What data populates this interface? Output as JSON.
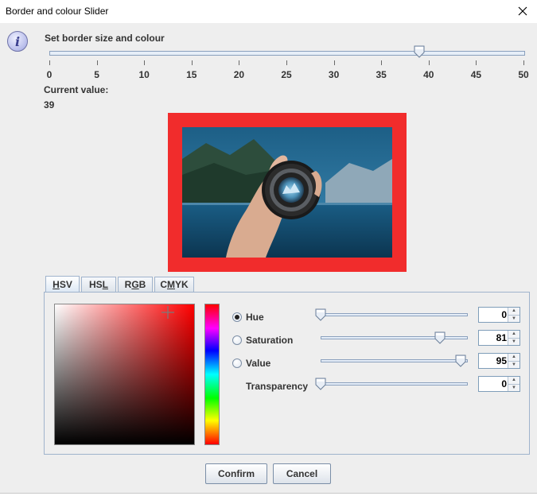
{
  "window": {
    "title": "Border and colour Slider"
  },
  "header": {
    "text": "Set border size and colour"
  },
  "border_slider": {
    "min": 0,
    "max": 50,
    "value": 39,
    "tick_labels": [
      "0",
      "5",
      "10",
      "15",
      "20",
      "25",
      "30",
      "35",
      "40",
      "45",
      "50"
    ]
  },
  "current_value": {
    "label": "Current value:",
    "value": "39"
  },
  "preview": {
    "border_color": "#f12c2c"
  },
  "tabs": [
    {
      "label": "HSV",
      "mnemonic_index": 0
    },
    {
      "label": "HSL",
      "mnemonic_index": 2
    },
    {
      "label": "RGB",
      "mnemonic_index": 1
    },
    {
      "label": "CMYK",
      "mnemonic_index": 1
    }
  ],
  "active_tab": "HSV",
  "hsv": {
    "hue": {
      "label": "Hue",
      "value": "0",
      "fraction": 0.0,
      "checked": true
    },
    "saturation": {
      "label": "Saturation",
      "value": "81",
      "fraction": 0.81,
      "checked": false
    },
    "value": {
      "label": "Value",
      "value": "95",
      "fraction": 0.95,
      "checked": false
    },
    "transparency": {
      "label": "Transparency",
      "value": "0",
      "fraction": 0.0
    }
  },
  "buttons": {
    "confirm": "Confirm",
    "cancel": "Cancel"
  },
  "icons": {
    "info": "info-icon",
    "close": "close-icon"
  }
}
